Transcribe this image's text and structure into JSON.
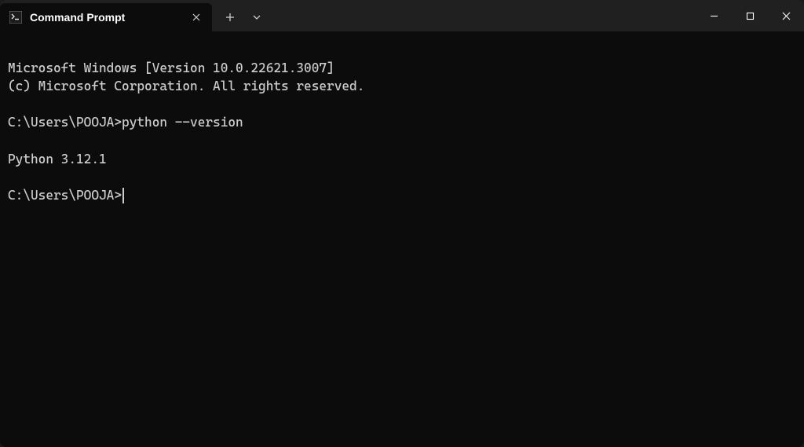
{
  "titlebar": {
    "tab": {
      "title": "Command Prompt",
      "icon_name": "cmd-icon"
    }
  },
  "terminal": {
    "line_version": "Microsoft Windows [Version 10.0.22621.3007]",
    "line_copyright": "(c) Microsoft Corporation. All rights reserved.",
    "prompt1": "C:\\Users\\POOJA>",
    "command1": "python --version",
    "output1": "Python 3.12.1",
    "prompt2": "C:\\Users\\POOJA>"
  }
}
